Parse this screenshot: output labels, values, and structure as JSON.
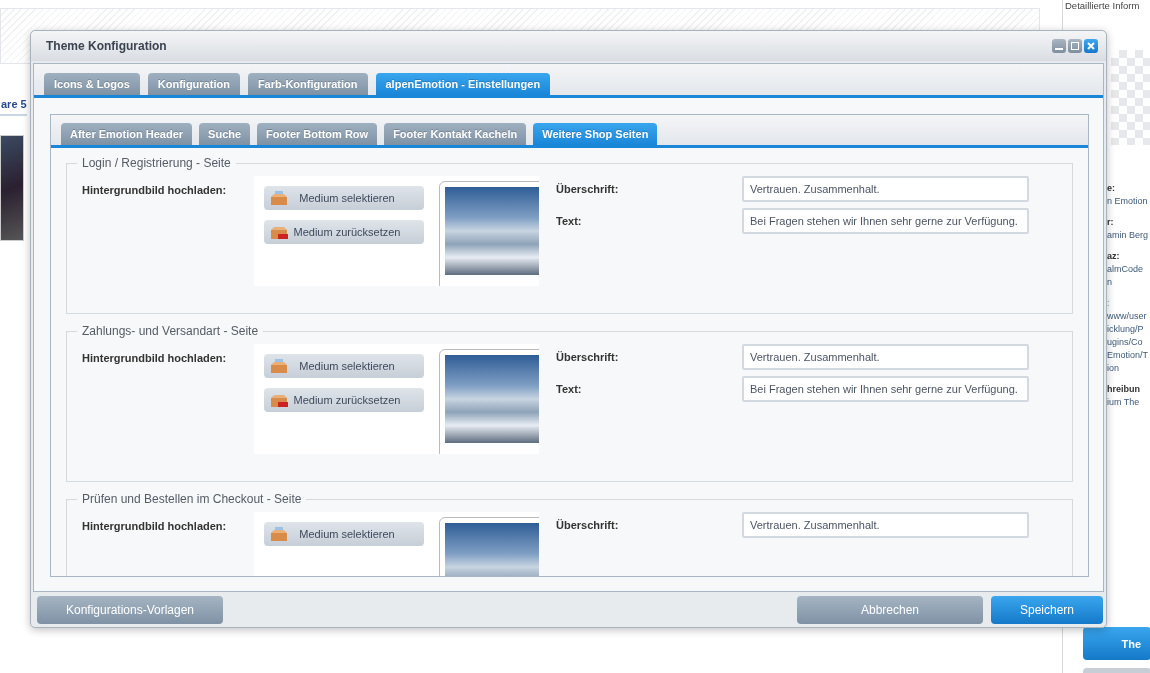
{
  "background": {
    "left_label": "are 5",
    "right_panel": {
      "top_text": "Detaillierte Inform",
      "lines": [
        {
          "kind": "label",
          "text": "e:"
        },
        {
          "kind": "value",
          "text": "n Emotion"
        },
        {
          "kind": "label",
          "text": "r:"
        },
        {
          "kind": "value",
          "text": "amin Berg"
        },
        {
          "kind": "label",
          "text": "az:"
        },
        {
          "kind": "value",
          "text": "almCode"
        },
        {
          "kind": "value",
          "text": "n"
        },
        {
          "kind": "link",
          "text": ":"
        },
        {
          "kind": "value",
          "text": "www/user"
        },
        {
          "kind": "value",
          "text": "icklung/P"
        },
        {
          "kind": "value",
          "text": "ugins/Co"
        },
        {
          "kind": "value",
          "text": "Emotion/T"
        },
        {
          "kind": "value",
          "text": "ion"
        },
        {
          "kind": "label",
          "text": "hreibun"
        },
        {
          "kind": "value",
          "text": "ium The"
        }
      ],
      "button": "The"
    }
  },
  "window": {
    "title": "Theme Konfiguration"
  },
  "tabs": [
    {
      "label": "Icons & Logos",
      "selected": false
    },
    {
      "label": "Konfiguration",
      "selected": false
    },
    {
      "label": "Farb-Konfiguration",
      "selected": false
    },
    {
      "label": "alpenEmotion - Einstellungen",
      "selected": true
    }
  ],
  "subtabs": [
    {
      "label": "After Emotion Header",
      "selected": false
    },
    {
      "label": "Suche",
      "selected": false
    },
    {
      "label": "Footer Bottom Row",
      "selected": false
    },
    {
      "label": "Footer Kontakt Kacheln",
      "selected": false
    },
    {
      "label": "Weitere Shop Seiten",
      "selected": true
    }
  ],
  "sections": [
    {
      "legend": "Login / Registrierung - Seite",
      "upload_label": "Hintergrundbild hochladen:",
      "buttons": [
        {
          "kind": "select",
          "label": "Medium selektieren"
        },
        {
          "kind": "reset",
          "label": "Medium zurücksetzen"
        }
      ],
      "fields": [
        {
          "label": "Überschrift:",
          "value": "Vertrauen. Zusammenhalt."
        },
        {
          "label": "Text:",
          "value": "Bei Fragen stehen wir Ihnen sehr gerne zur Verfügung."
        }
      ]
    },
    {
      "legend": "Zahlungs- und Versandart - Seite",
      "upload_label": "Hintergrundbild hochladen:",
      "buttons": [
        {
          "kind": "select",
          "label": "Medium selektieren"
        },
        {
          "kind": "reset",
          "label": "Medium zurücksetzen"
        }
      ],
      "fields": [
        {
          "label": "Überschrift:",
          "value": "Vertrauen. Zusammenhalt."
        },
        {
          "label": "Text:",
          "value": "Bei Fragen stehen wir Ihnen sehr gerne zur Verfügung."
        }
      ]
    },
    {
      "legend": "Prüfen und Bestellen im Checkout - Seite",
      "upload_label": "Hintergrundbild hochladen:",
      "buttons": [
        {
          "kind": "select",
          "label": "Medium selektieren"
        }
      ],
      "fields": [
        {
          "label": "Überschrift:",
          "value": "Vertrauen. Zusammenhalt."
        }
      ]
    }
  ],
  "footer": {
    "left_button": "Konfigurations-Vorlagen",
    "cancel_button": "Abbrechen",
    "save_button": "Speichern"
  }
}
